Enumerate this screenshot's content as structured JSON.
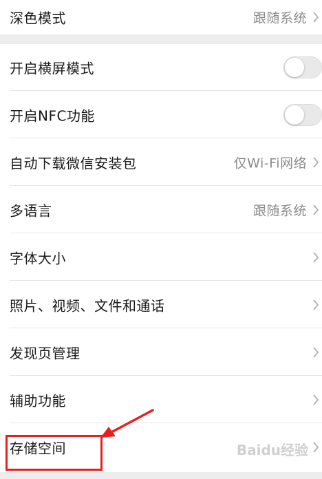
{
  "settings": {
    "dark_mode": {
      "label": "深色模式",
      "value": "跟随系统"
    },
    "landscape": {
      "label": "开启横屏模式",
      "enabled": false
    },
    "nfc": {
      "label": "开启NFC功能",
      "enabled": false
    },
    "auto_download": {
      "label": "自动下载微信安装包",
      "value": "仅Wi-Fi网络"
    },
    "language": {
      "label": "多语言",
      "value": "跟随系统"
    },
    "font_size": {
      "label": "字体大小"
    },
    "media": {
      "label": "照片、视频、文件和通话"
    },
    "discover": {
      "label": "发现页管理"
    },
    "accessibility": {
      "label": "辅助功能"
    },
    "storage": {
      "label": "存储空间"
    }
  },
  "annotation": {
    "highlight_color": "#e5201f"
  },
  "watermark": {
    "text": "Baidu经验"
  },
  "icons": {
    "chevron": "chevron-right-icon",
    "toggle": "toggle-switch",
    "arrow": "red-arrow"
  }
}
